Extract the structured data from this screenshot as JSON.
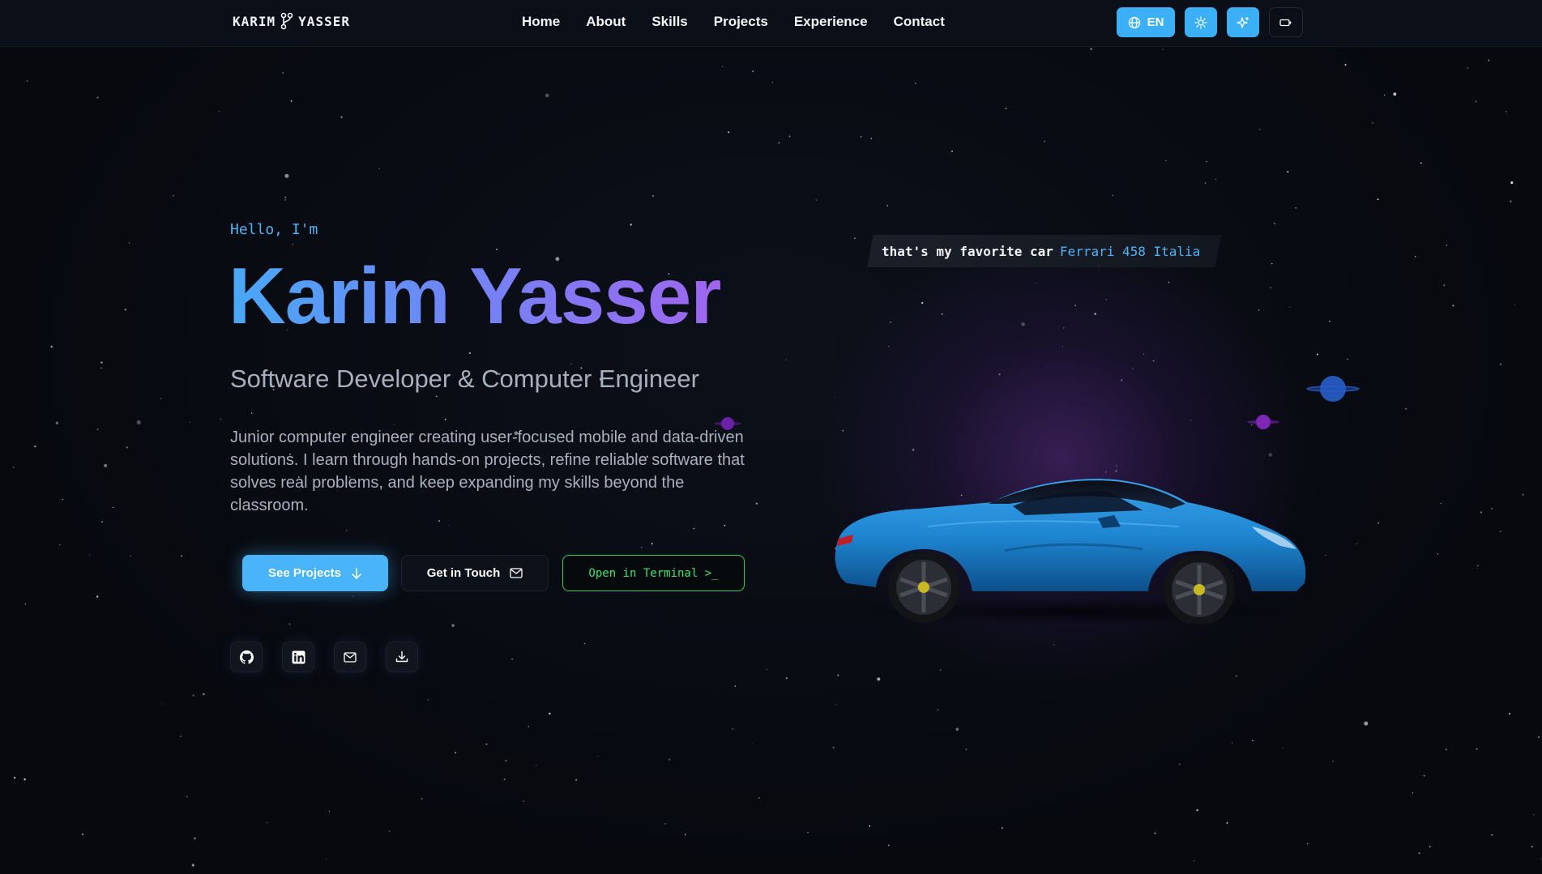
{
  "logo": {
    "text_left": "KARIM",
    "text_right": "YASSER"
  },
  "nav": {
    "links": [
      "Home",
      "About",
      "Skills",
      "Projects",
      "Experience",
      "Contact"
    ],
    "language_label": "EN"
  },
  "hero": {
    "greeting": "Hello, I'm",
    "name": "Karim Yasser",
    "role": "Software Developer & Computer Engineer",
    "bio": "Junior computer engineer creating user-focused mobile and data-driven solutions. I learn through hands-on projects, refine reliable software that solves real problems, and keep expanding my skills beyond the classroom.",
    "buttons": {
      "projects": "See Projects",
      "contact": "Get in Touch",
      "terminal": "Open in Terminal >_"
    },
    "socials": [
      "github-icon",
      "linkedin-icon",
      "mail-icon",
      "download-icon"
    ]
  },
  "showcase": {
    "caption_prefix": "that's my favorite car",
    "caption_highlight": "Ferrari 458 Italia"
  },
  "colors": {
    "accent": "#49b4f9",
    "terminal_green": "#3ee070",
    "name_gradient_start": "#48a9f8",
    "name_gradient_end": "#9f66f0",
    "car_body": "#1f86d2"
  }
}
